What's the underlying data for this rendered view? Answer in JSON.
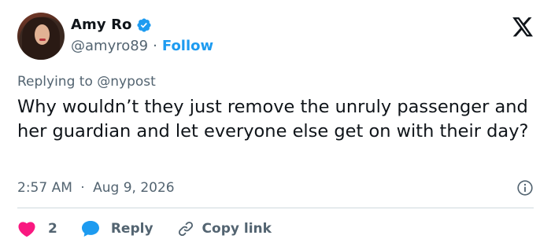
{
  "author": {
    "display_name": "Amy Ro",
    "handle": "@amyro89",
    "separator": "·",
    "follow_label": "Follow"
  },
  "tweet": {
    "replying_prefix": "Replying to",
    "replying_to": "@nypost",
    "text": "Why wouldn’t they just remove the unruly passenger and her guardian and let everyone else get on with their day?",
    "time": "2:57 AM",
    "separator": "·",
    "date": "Aug 9, 2026"
  },
  "actions": {
    "like_count": "2",
    "reply_label": "Reply",
    "copy_link_label": "Copy link"
  },
  "colors": {
    "accent": "#1d9bf0",
    "like": "#f91880",
    "text": "#0f1419",
    "muted": "#536471",
    "divider": "#cfd9de"
  },
  "icons": [
    "verified-badge-icon",
    "x-logo-icon",
    "info-icon",
    "heart-icon",
    "reply-bubble-icon",
    "link-icon"
  ]
}
